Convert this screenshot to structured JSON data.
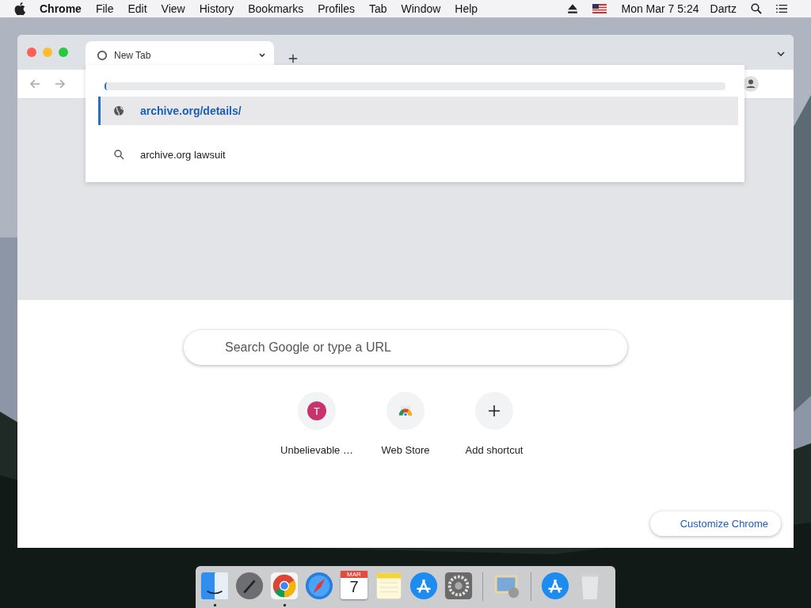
{
  "menubar": {
    "app": "Chrome",
    "items": [
      "File",
      "Edit",
      "View",
      "History",
      "Bookmarks",
      "Profiles",
      "Tab",
      "Window",
      "Help"
    ],
    "clock": "Mon Mar 7  5:24",
    "user": "Dartz"
  },
  "browser": {
    "tabs": [
      {
        "title": "New Tab",
        "selected": true
      }
    ],
    "suggestions": [
      {
        "kind": "url",
        "text": "archive.org/details/",
        "selected": true
      },
      {
        "kind": "search",
        "text": "archive.org lawsuit",
        "selected": false
      }
    ]
  },
  "new_tab": {
    "search": {
      "placeholder": "Search Google or type a URL"
    },
    "shortcuts": [
      {
        "kind": "site",
        "initial": "T",
        "label": "Unbelievable …"
      },
      {
        "kind": "store",
        "label": "Web Store"
      },
      {
        "kind": "add",
        "label": "Add shortcut"
      }
    ],
    "customize_button": "Customize Chrome"
  },
  "dock": [
    {
      "kind": "finder",
      "running": true
    },
    {
      "kind": "launchpad",
      "running": false
    },
    {
      "kind": "chrome",
      "running": true
    },
    {
      "kind": "safari",
      "running": false
    },
    {
      "kind": "calendar",
      "month": "MAR",
      "day": "7",
      "running": false
    },
    {
      "kind": "notes",
      "running": false
    },
    {
      "kind": "appstore",
      "running": false
    },
    {
      "kind": "settings",
      "running": false
    },
    {
      "kind": "separator"
    },
    {
      "kind": "preview",
      "running": false
    },
    {
      "kind": "separator"
    },
    {
      "kind": "appstore",
      "running": false
    },
    {
      "kind": "trash",
      "running": false
    }
  ]
}
